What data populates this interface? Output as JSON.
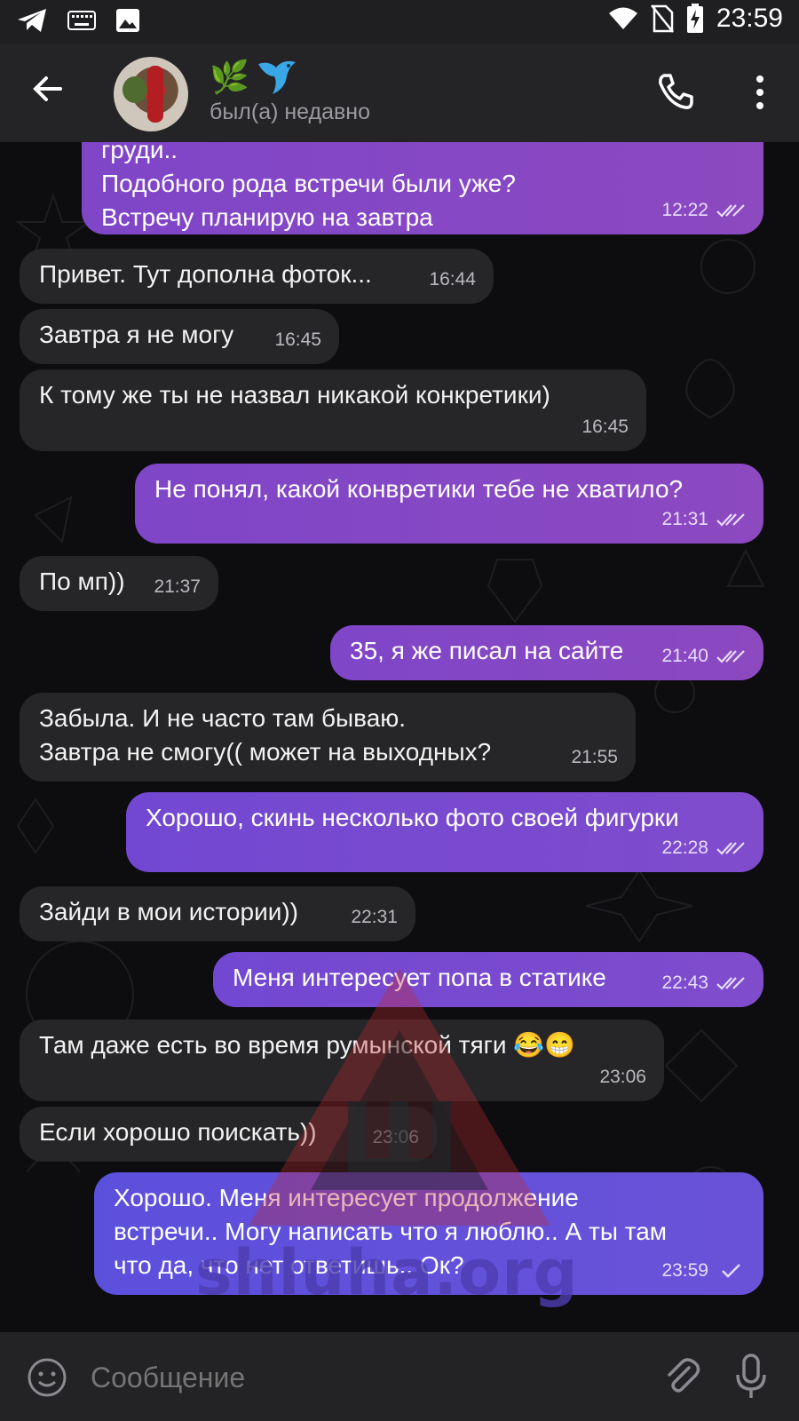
{
  "status_bar": {
    "time": "23:59"
  },
  "header": {
    "emoji": "🌿",
    "status": "был(а) недавно"
  },
  "messages": [
    {
      "id": 0,
      "dir": "out",
      "text_lines": [
        "груди..",
        "Подобного рода встречи были уже?",
        "Встречу планирую на завтра"
      ],
      "time": "12:22"
    },
    {
      "id": 1,
      "dir": "in",
      "text": "Привет. Тут дополна фоток...",
      "time": "16:44"
    },
    {
      "id": 2,
      "dir": "in",
      "text": "Завтра я не могу",
      "time": "16:45"
    },
    {
      "id": 3,
      "dir": "in",
      "text": "К тому же ты не назвал никакой конкретики)",
      "time": "16:45"
    },
    {
      "id": 4,
      "dir": "out",
      "text": "Не понял, какой конвретики тебе не хватило?",
      "time": "21:31"
    },
    {
      "id": 5,
      "dir": "in",
      "text": "По мп))",
      "time": "21:37"
    },
    {
      "id": 6,
      "dir": "out",
      "text": "35, я же писал на сайте",
      "time": "21:40"
    },
    {
      "id": 7,
      "dir": "in",
      "text_lines": [
        "Забыла. И не часто там бываю.",
        "Завтра не смогу(( может на выходных?"
      ],
      "time": "21:55"
    },
    {
      "id": 8,
      "dir": "out",
      "text": "Хорошо, скинь несколько фото своей фигурки",
      "time": "22:28"
    },
    {
      "id": 9,
      "dir": "in",
      "text": "Зайди в мои истории))",
      "time": "22:31"
    },
    {
      "id": 10,
      "dir": "out",
      "text": "Меня интересует попа в статике",
      "time": "22:43"
    },
    {
      "id": 11,
      "dir": "in",
      "text": "Там даже есть во время румынской тяги 😂😁",
      "time": "23:06"
    },
    {
      "id": 12,
      "dir": "in",
      "text": "Если хорошо поискать))",
      "time": "23:06"
    },
    {
      "id": 13,
      "dir": "out",
      "text_lines": [
        "Хорошо. Меня интересует продолжение",
        "встречи.. Могу написать что я люблю.. А ты там",
        "что да, что нет ответишь.. Ок?"
      ],
      "time": "23:59"
    }
  ],
  "input": {
    "placeholder": "Сообщение"
  },
  "watermark": {
    "letter": "Ш",
    "text": "shluha.org"
  },
  "colors": {
    "outgoing_bubble": "#8a49c4",
    "incoming_bubble": "#262628",
    "header_bg": "#242426"
  }
}
